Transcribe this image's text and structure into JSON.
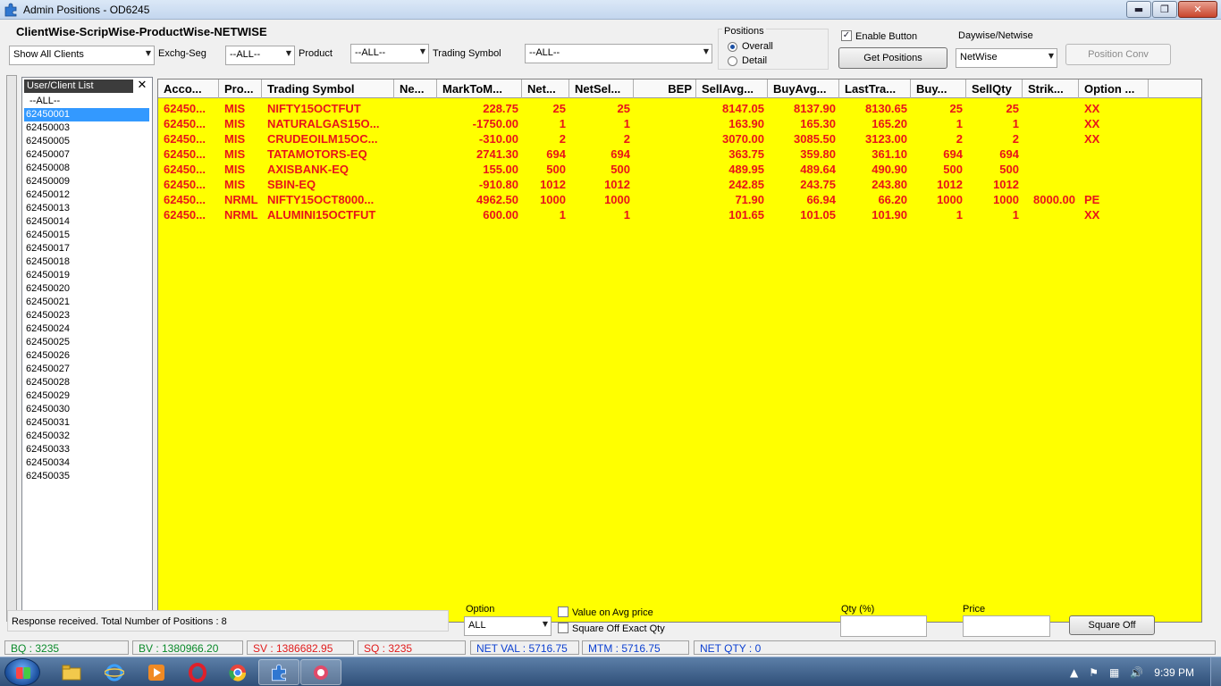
{
  "window": {
    "title": "Admin Positions - OD6245",
    "minimize_glyph": "▬",
    "maximize_glyph": "❐",
    "close_glyph": "✕"
  },
  "toolbar": {
    "heading": "ClientWise-ScripWise-ProductWise-NETWISE",
    "client_filter": "Show All Clients",
    "exchg_label": "Exchg-Seg",
    "exchg_value": "--ALL--",
    "product_label": "Product",
    "product_value": "--ALL--",
    "symbol_label": "Trading Symbol",
    "symbol_value": "--ALL--",
    "positions_group": "Positions",
    "radio_overall": "Overall",
    "radio_detail": "Detail",
    "enable_button_label": "Enable Button",
    "enable_button_checked": true,
    "get_positions": "Get Positions",
    "daywise_label": "Daywise/Netwise",
    "daywise_value": "NetWise",
    "position_conv": "Position Conv"
  },
  "client_list": {
    "header": "User/Client List",
    "close_glyph": "✕",
    "items": [
      "--ALL--",
      "62450001",
      "62450003",
      "62450005",
      "62450007",
      "62450008",
      "62450009",
      "62450012",
      "62450013",
      "62450014",
      "62450015",
      "62450017",
      "62450018",
      "62450019",
      "62450020",
      "62450021",
      "62450023",
      "62450024",
      "62450025",
      "62450026",
      "62450027",
      "62450028",
      "62450029",
      "62450030",
      "62450031",
      "62450032",
      "62450033",
      "62450034",
      "62450035"
    ],
    "selected_index": 1
  },
  "grid": {
    "columns": [
      "Acco...",
      "Pro...",
      "Trading Symbol",
      "Ne...",
      "MarkToM...",
      "Net...",
      "NetSel...",
      "BEP",
      "SellAvg...",
      "BuyAvg...",
      "LastTra...",
      "Buy...",
      "SellQty",
      "Strik...",
      "Option ..."
    ],
    "rows": [
      [
        "62450...",
        "MIS",
        "NIFTY15OCTFUT",
        "",
        "228.75",
        "25",
        "25",
        "",
        "8147.05",
        "8137.90",
        "8130.65",
        "25",
        "25",
        "",
        "XX"
      ],
      [
        "62450...",
        "MIS",
        "NATURALGAS15O...",
        "",
        "-1750.00",
        "1",
        "1",
        "",
        "163.90",
        "165.30",
        "165.20",
        "1",
        "1",
        "",
        "XX"
      ],
      [
        "62450...",
        "MIS",
        "CRUDEOILM15OC...",
        "",
        "-310.00",
        "2",
        "2",
        "",
        "3070.00",
        "3085.50",
        "3123.00",
        "2",
        "2",
        "",
        "XX"
      ],
      [
        "62450...",
        "MIS",
        "TATAMOTORS-EQ",
        "",
        "2741.30",
        "694",
        "694",
        "",
        "363.75",
        "359.80",
        "361.10",
        "694",
        "694",
        "",
        ""
      ],
      [
        "62450...",
        "MIS",
        "AXISBANK-EQ",
        "",
        "155.00",
        "500",
        "500",
        "",
        "489.95",
        "489.64",
        "490.90",
        "500",
        "500",
        "",
        ""
      ],
      [
        "62450...",
        "MIS",
        "SBIN-EQ",
        "",
        "-910.80",
        "1012",
        "1012",
        "",
        "242.85",
        "243.75",
        "243.80",
        "1012",
        "1012",
        "",
        ""
      ],
      [
        "62450...",
        "NRML",
        "NIFTY15OCT8000...",
        "",
        "4962.50",
        "1000",
        "1000",
        "",
        "71.90",
        "66.94",
        "66.20",
        "1000",
        "1000",
        "8000.00",
        "PE"
      ],
      [
        "62450...",
        "NRML",
        "ALUMINI15OCTFUT",
        "",
        "600.00",
        "1",
        "1",
        "",
        "101.65",
        "101.05",
        "101.90",
        "1",
        "1",
        "",
        "XX"
      ]
    ]
  },
  "bottom": {
    "status_message": "Response received. Total Number of Positions : 8",
    "option_label": "Option",
    "option_value": "ALL",
    "value_on_avg": "Value on Avg  price",
    "square_off_exact": "Square Off Exact Qty",
    "qty_label": "Qty (%)",
    "qty_value": "",
    "price_label": "Price",
    "price_value": "",
    "square_off_button": "Square Off"
  },
  "statusbar": {
    "bq": "BQ : 3235",
    "bv": "BV : 1380966.20",
    "sv": "SV : 1386682.95",
    "sq": "SQ : 3235",
    "net_val": "NET VAL : 5716.75",
    "mtm": "MTM : 5716.75",
    "net_qty": "NET QTY : 0"
  },
  "taskbar": {
    "clock": "9:39 PM",
    "apps": [
      "file-explorer-icon",
      "internet-explorer-icon",
      "media-player-icon",
      "opera-icon",
      "chrome-icon",
      "puzzle-app-icon",
      "trading-app-icon"
    ]
  }
}
